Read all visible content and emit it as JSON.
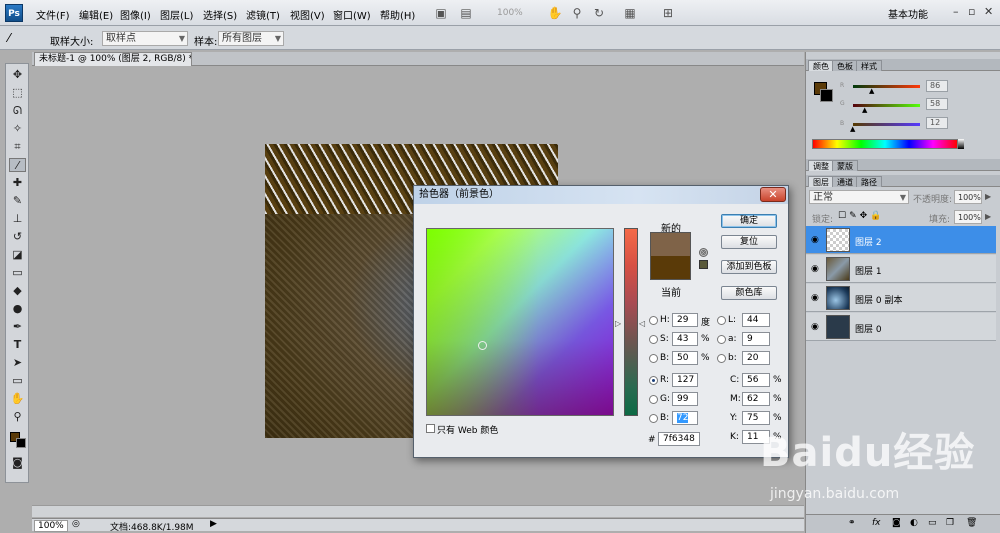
{
  "app": {
    "logo_text": "Ps",
    "menu": [
      "文件(F)",
      "编辑(E)",
      "图像(I)",
      "图层(L)",
      "选择(S)",
      "滤镜(T)",
      "视图(V)",
      "窗口(W)",
      "帮助(H)"
    ],
    "zoom_field": "100%",
    "workspace": "基本功能"
  },
  "options": {
    "sample_size_label": "取样大小:",
    "sample_size_value": "取样点",
    "sample_label": "样本:",
    "sample_value": "所有图层"
  },
  "document": {
    "tab_title": "未标题-1 @ 100% (图层 2, RGB/8) *",
    "status_zoom": "100%",
    "status_doc": "文档:468.8K/1.98M"
  },
  "dialog": {
    "title": "拾色器（前景色）",
    "new_label": "新的",
    "current_label": "当前",
    "new_color": "#7f6348",
    "current_color": "#5a3a08",
    "buttons": {
      "ok": "确定",
      "reset": "复位",
      "add_swatch": "添加到色板",
      "libraries": "颜色库"
    },
    "fields": {
      "H": {
        "label": "H:",
        "value": "29",
        "unit": "度"
      },
      "S": {
        "label": "S:",
        "value": "43",
        "unit": "%"
      },
      "B": {
        "label": "B:",
        "value": "50",
        "unit": "%"
      },
      "R": {
        "label": "R:",
        "value": "127"
      },
      "G": {
        "label": "G:",
        "value": "99"
      },
      "Bl": {
        "label": "B:",
        "value": "72"
      },
      "L": {
        "label": "L:",
        "value": "44"
      },
      "a": {
        "label": "a:",
        "value": "9"
      },
      "b": {
        "label": "b:",
        "value": "20"
      },
      "C": {
        "label": "C:",
        "value": "56",
        "unit": "%"
      },
      "M": {
        "label": "M:",
        "value": "62",
        "unit": "%"
      },
      "Y": {
        "label": "Y:",
        "value": "75",
        "unit": "%"
      },
      "K": {
        "label": "K:",
        "value": "11",
        "unit": "%"
      }
    },
    "hex_label": "#",
    "hex_value": "7f6348",
    "web_only_label": "只有 Web 颜色"
  },
  "color_panel": {
    "tabs": [
      "颜色",
      "色板",
      "样式"
    ],
    "r_label": "R",
    "g_label": "G",
    "b_label": "B",
    "r": "86",
    "g": "58",
    "b": "12"
  },
  "adjust_tabs": [
    "调整",
    "蒙版"
  ],
  "layers_panel": {
    "tabs": [
      "图层",
      "通道",
      "路径"
    ],
    "blend_mode": "正常",
    "opacity_label": "不透明度:",
    "opacity": "100%",
    "lock_label": "锁定:",
    "fill_label": "填充:",
    "fill": "100%",
    "layers": [
      "图层 2",
      "图层 1",
      "图层 0 副本",
      "图层 0"
    ]
  },
  "watermark": {
    "text": "Baidu经验",
    "url": "jingyan.baidu.com"
  }
}
